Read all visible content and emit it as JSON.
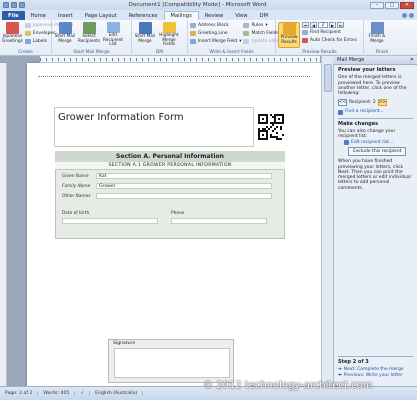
{
  "window": {
    "title": "Document1 [Compatibility Mode] - Microsoft Word"
  },
  "tabs": [
    "File",
    "Home",
    "Insert",
    "Page Layout",
    "References",
    "Mailings",
    "Review",
    "View",
    "DM"
  ],
  "active_tab": "Mailings",
  "ribbon": {
    "create": {
      "label": "Create",
      "japanese_greetings": "Japanese Greetings",
      "japanese_postcard": "Japanese Postcard",
      "envelopes": "Envelopes",
      "labels": "Labels"
    },
    "start_mail_merge": {
      "label": "Start Mail Merge",
      "start": "Start Mail Merge",
      "select_recipients": "Select Recipients",
      "edit_recipient_list": "Edit Recipient List"
    },
    "dm": {
      "label": "DM",
      "start_mail_merge": "Start Mail Merge",
      "highlight_merge_fields": "Highlight Merge Fields"
    },
    "write_insert": {
      "label": "Write & Insert Fields",
      "address_block": "Address Block",
      "greeting_line": "Greeting Line",
      "insert_merge_field": "Insert Merge Field",
      "rules": "Rules",
      "match_fields": "Match Fields",
      "update_labels": "Update Labels"
    },
    "preview_results": {
      "label": "Preview Results",
      "preview": "Preview Results",
      "record": "2",
      "find_recipient": "Find Recipient",
      "auto_check": "Auto Check for Errors"
    },
    "finish": {
      "label": "Finish",
      "finish_merge": "Finish & Merge"
    }
  },
  "document": {
    "form_title": "Grower Information Form",
    "section_heading": "Section A. Personal Information",
    "subsection_heading": "SECTION A.1 GROWER PERSONAL  INFORMATION",
    "fields": {
      "given_name_label": "Given Name",
      "given_name_value": "Kat",
      "family_name_label": "Family Name",
      "family_name_value": "Grower",
      "other_names_label": "Other Names",
      "other_names_value": "",
      "dob_label": "Date of birth",
      "phone_label": "Phone"
    },
    "signature_label": "Signature"
  },
  "pane": {
    "header": "Mail Merge",
    "preview_title": "Preview your letters",
    "preview_text": "One of the merged letters is previewed here. To preview another letter, click one of the following:",
    "recipient": "Recipient: 2",
    "prev_btn": "<<",
    "next_btn": ">>",
    "find_recipient": "Find a recipient...",
    "make_changes_title": "Make changes",
    "make_changes_text": "You can also change your recipient list:",
    "edit_recipient": "Edit recipient list...",
    "exclude_btn": "Exclude this recipient",
    "finish_text": "When you have finished previewing your letters, click Next. Then you can print the merged letters or edit individual letters to add personal comments.",
    "step": "Step 2 of 3",
    "next_step": "Next: Complete the merge",
    "prev_step": "Previous: Write your letter"
  },
  "status": {
    "page": "Page: 2 of 2",
    "words": "Words: 405",
    "language": "English (Australia)"
  },
  "watermark": "© 2012 technology-architect.com",
  "colors": {
    "file_tab": "#2a5ea8",
    "active_button": "#fbd978",
    "section_header": "#cfd8cf"
  }
}
